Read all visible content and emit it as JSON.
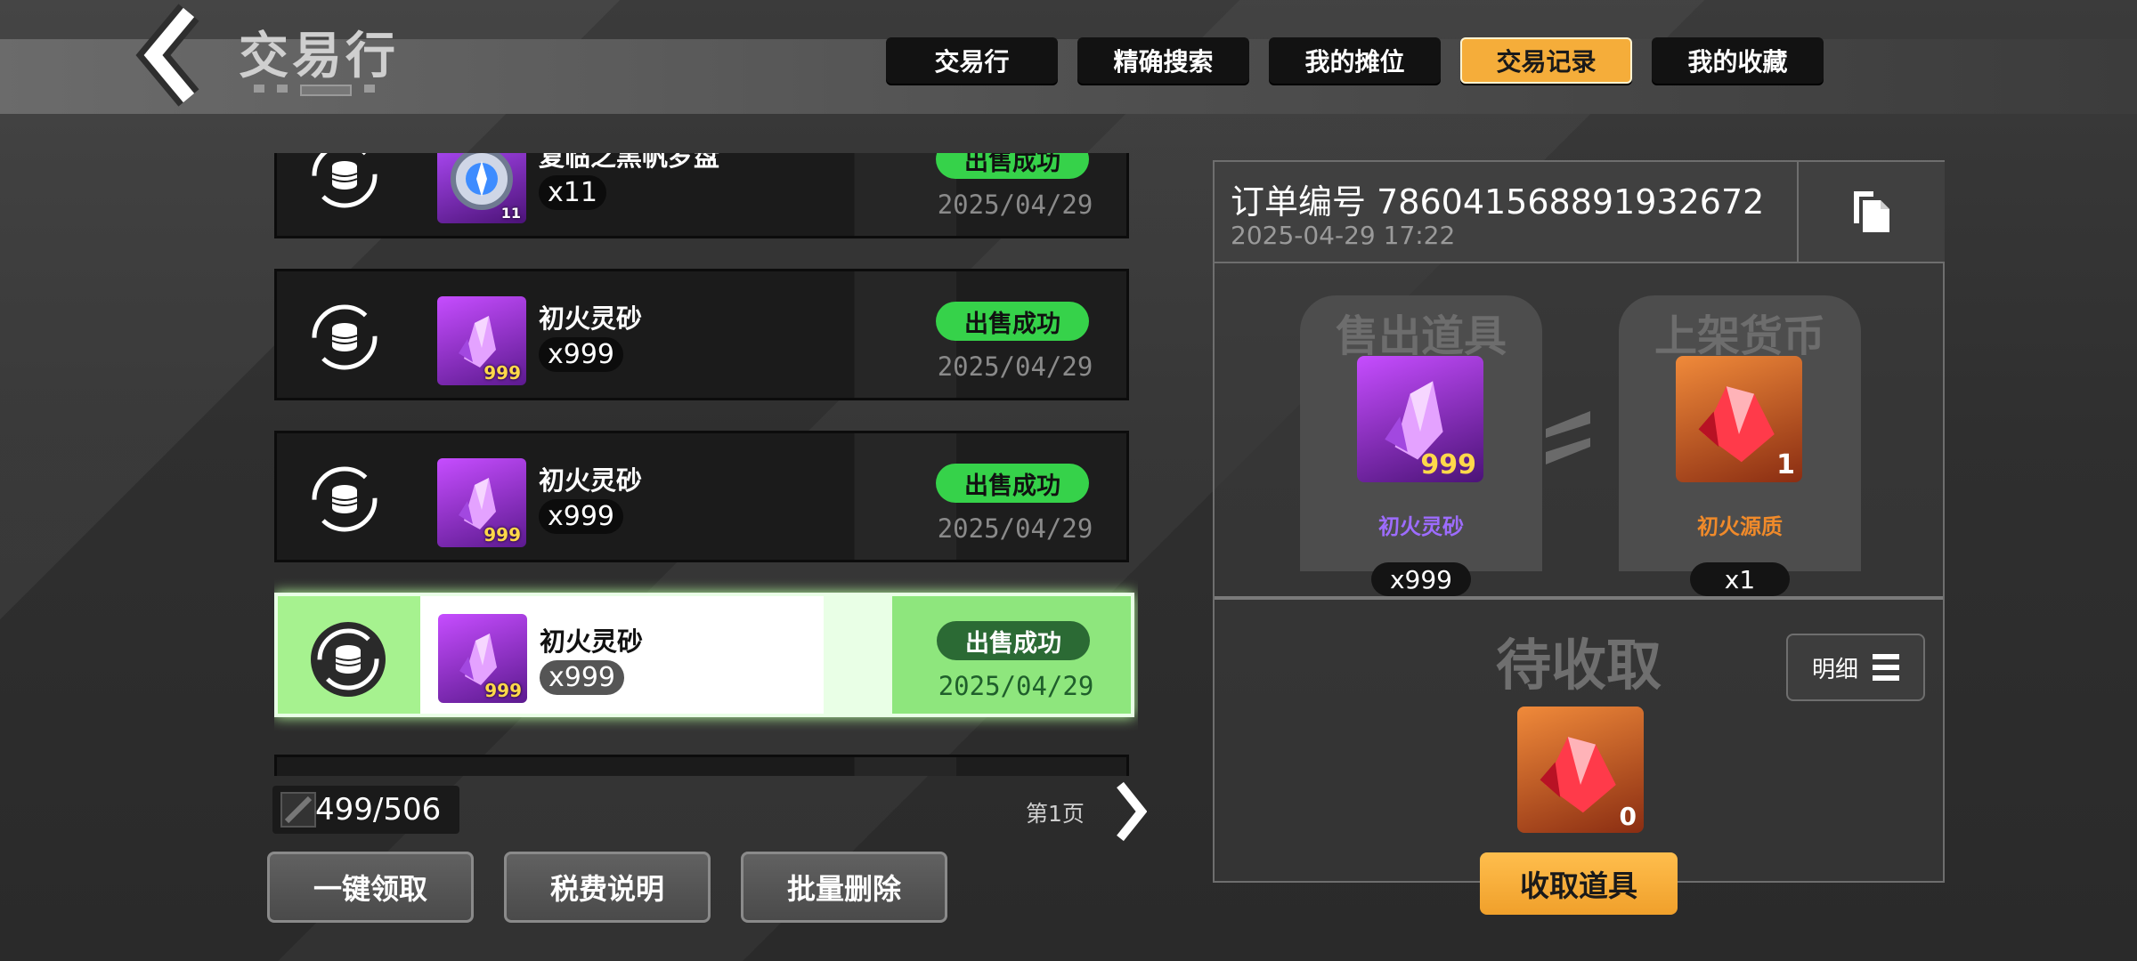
{
  "header": {
    "title": "交易行"
  },
  "tabs": [
    {
      "label": "交易行",
      "active": false
    },
    {
      "label": "精确搜索",
      "active": false
    },
    {
      "label": "我的摊位",
      "active": false
    },
    {
      "label": "交易记录",
      "active": true
    },
    {
      "label": "我的收藏",
      "active": false
    }
  ],
  "records": [
    {
      "name": "复临之黑帆罗盘",
      "count": "x11",
      "badge": "11",
      "status": "出售成功",
      "date": "2025/04/29",
      "icon": "compass-icon"
    },
    {
      "name": "初火灵砂",
      "count": "x999",
      "badge": "999",
      "status": "出售成功",
      "date": "2025/04/29",
      "icon": "purple-crystal-icon"
    },
    {
      "name": "初火灵砂",
      "count": "x999",
      "badge": "999",
      "status": "出售成功",
      "date": "2025/04/29",
      "icon": "purple-crystal-icon"
    },
    {
      "name": "初火灵砂",
      "count": "x999",
      "badge": "999",
      "status": "出售成功",
      "date": "2025/04/29",
      "icon": "purple-crystal-icon",
      "selected": true
    }
  ],
  "pagination": {
    "counter": "499/506",
    "page": "第1页"
  },
  "buttons": {
    "claim_all": "一键领取",
    "tax_info": "税费说明",
    "batch_delete": "批量删除"
  },
  "detail": {
    "order_label": "订单编号",
    "order_number": "786041568891932672",
    "order_time": "2025-04-29 17:22",
    "sold_title": "售出道具",
    "sold_item": {
      "name": "初火灵砂",
      "qty": "999",
      "count": "x999",
      "color": "#9d6cff"
    },
    "price_title": "上架货币",
    "price_item": {
      "name": "初火源质",
      "qty": "1",
      "count": "x1",
      "color": "#f08a2a"
    },
    "pending_label": "待收取",
    "details_button": "明细",
    "reward_qty": "0",
    "collect_button": "收取道具"
  },
  "colors": {
    "accent": "#f5ad3a",
    "success": "#36d24a"
  }
}
